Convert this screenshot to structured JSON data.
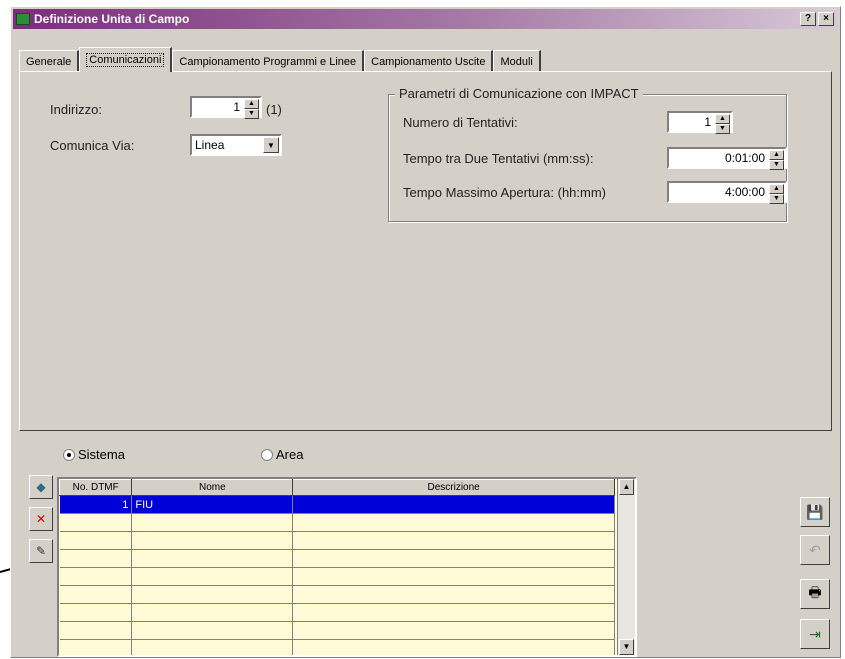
{
  "window": {
    "title": "Definizione Unita di Campo",
    "help_label": "?",
    "close_label": "×"
  },
  "tabs": [
    {
      "label": "Generale"
    },
    {
      "label": "Comunicazioni"
    },
    {
      "label": "Campionamento Programmi e Linee"
    },
    {
      "label": "Campionamento Uscite"
    },
    {
      "label": "Moduli"
    }
  ],
  "form": {
    "indirizzo_label": "Indirizzo:",
    "indirizzo_value": "1",
    "indirizzo_note": "(1)",
    "comunica_label": "Comunica Via:",
    "comunica_value": "Linea"
  },
  "params": {
    "legend": "Parametri di Comunicazione con IMPACT",
    "tentativi_label": "Numero di Tentativi:",
    "tentativi_value": "1",
    "tempo_tra_label": "Tempo tra Due Tentativi (mm:ss):",
    "tempo_tra_value": "0:01:00",
    "tempo_max_label": "Tempo Massimo Apertura: (hh:mm)",
    "tempo_max_value": "4:00:00"
  },
  "selection": {
    "sistema_label": "Sistema",
    "area_label": "Area"
  },
  "grid": {
    "headers": [
      "No. DTMF",
      "Nome",
      "Descrizione"
    ],
    "rows": [
      {
        "dtmf": "1",
        "nome": "FIU",
        "descrizione": ""
      }
    ]
  },
  "icons": {
    "add": "add-icon",
    "delete": "delete-icon",
    "edit": "edit-icon",
    "save": "save-icon",
    "undo": "undo-icon",
    "print": "print-icon",
    "exit": "exit-icon"
  }
}
